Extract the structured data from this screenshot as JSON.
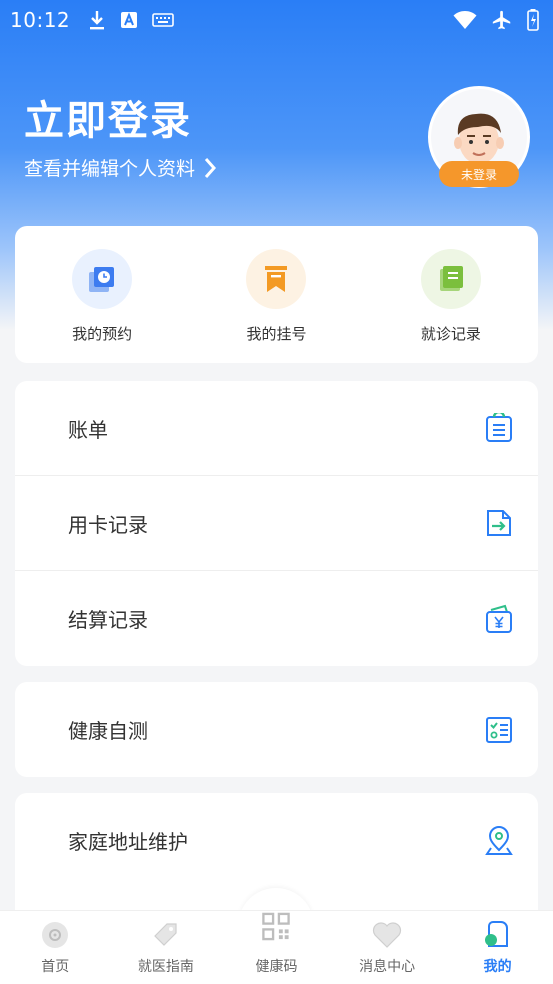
{
  "status_bar": {
    "time": "10:12"
  },
  "profile": {
    "title": "立即登录",
    "subtitle": "查看并编辑个人资料",
    "badge": "未登录"
  },
  "quick_actions": [
    {
      "label": "我的预约",
      "icon": "calendar-clock-icon",
      "color": "#3d7cf0",
      "bg": "#e9f1fe"
    },
    {
      "label": "我的挂号",
      "icon": "ticket-icon",
      "color": "#f39a24",
      "bg": "#fdf2e3"
    },
    {
      "label": "就诊记录",
      "icon": "notebook-icon",
      "color": "#7bbf3d",
      "bg": "#eef6e4"
    }
  ],
  "menu_group_1": [
    {
      "label": "账单",
      "icon": "clipboard-icon"
    },
    {
      "label": "用卡记录",
      "icon": "card-transfer-icon"
    },
    {
      "label": "结算记录",
      "icon": "wallet-yen-icon"
    }
  ],
  "menu_group_2": [
    {
      "label": "健康自测",
      "icon": "checklist-icon"
    }
  ],
  "menu_group_3": [
    {
      "label": "家庭地址维护",
      "icon": "location-pin-icon"
    }
  ],
  "tabs": [
    {
      "label": "首页",
      "icon": "home-disc-icon",
      "active": false
    },
    {
      "label": "就医指南",
      "icon": "tag-icon",
      "active": false
    },
    {
      "label": "健康码",
      "icon": "qr-code-icon",
      "active": false
    },
    {
      "label": "消息中心",
      "icon": "heart-icon",
      "active": false
    },
    {
      "label": "我的",
      "icon": "user-card-icon",
      "active": true
    }
  ],
  "colors": {
    "primary": "#2a7ef6",
    "accent": "#f5972b",
    "green": "#2fbf8a"
  }
}
